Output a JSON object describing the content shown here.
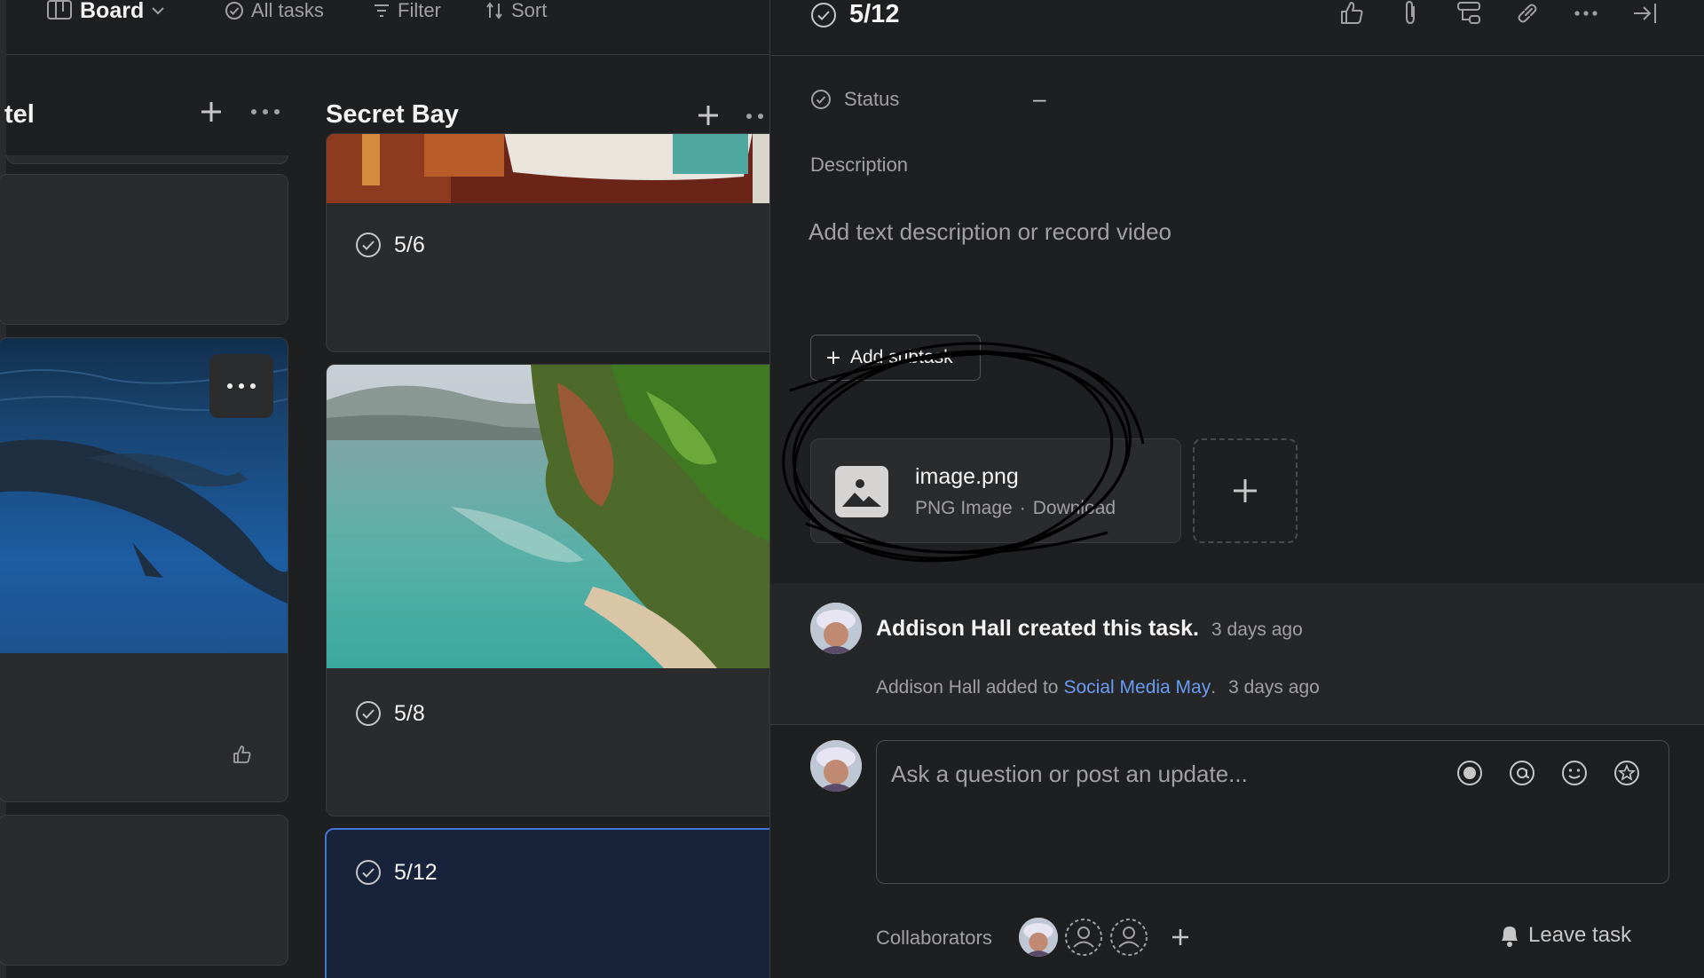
{
  "topbar": {
    "board_label": "Board",
    "all_tasks_label": "All tasks",
    "filter_label": "Filter",
    "sort_label": "Sort"
  },
  "columns": [
    {
      "title": "tel"
    },
    {
      "title": "Secret Bay"
    }
  ],
  "cards": {
    "task_1": "5/6",
    "task_2": "5/8",
    "task_3": "5/12"
  },
  "task_detail": {
    "title": "5/12",
    "status_label": "Status",
    "status_value": "–",
    "description_label": "Description",
    "description_placeholder": "Add text description or record video",
    "add_subtask_label": "Add subtask",
    "attachment": {
      "name": "image.png",
      "type": "PNG Image",
      "separator": "·",
      "download_label": "Download"
    },
    "activity": [
      {
        "actor": "Addison Hall created this task.",
        "time": "3 days ago"
      },
      {
        "actor": "Addison Hall added to",
        "link": "Social Media May",
        "suffix": ".",
        "time": "3 days ago"
      }
    ],
    "comment_placeholder": "Ask a question or post an update...",
    "collaborators_label": "Collaborators",
    "leave_task_label": "Leave task"
  },
  "icons": {
    "board": "board-icon",
    "check": "check-circle-icon",
    "like": "thumbs-up-icon",
    "attach": "paperclip-icon",
    "subtasks": "subtasks-icon",
    "link": "link-icon",
    "more": "more-icon",
    "close": "close-pane-icon"
  },
  "colors": {
    "background": "#1e1f21",
    "card": "#2a2b2d",
    "selected_card": "#17233b",
    "selected_border": "#4573d2",
    "link": "#6a9bf5"
  }
}
